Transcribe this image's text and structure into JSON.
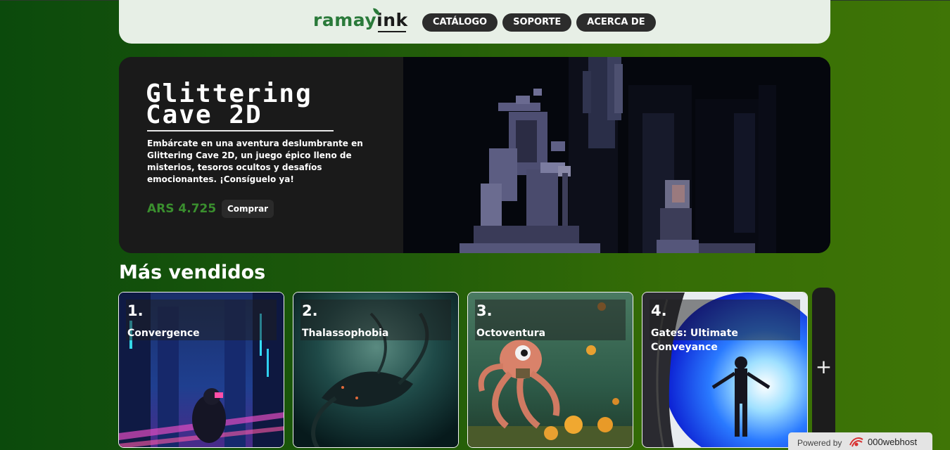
{
  "header": {
    "logo_part1": "ramay",
    "logo_part2": "ink",
    "nav": [
      "CATÁLOGO",
      "SOPORTE",
      "ACERCA DE"
    ]
  },
  "hero": {
    "title": "Glittering Cave 2D",
    "description": "Embárcate en una aventura deslumbrante en Glittering Cave 2D, un juego épico lleno de misterios, tesoros ocultos y desafíos emocionantes. ¡Consíguelo ya!",
    "price": "ARS 4.725",
    "buy_label": "Comprar"
  },
  "bestsellers": {
    "title": "Más vendidos",
    "items": [
      {
        "rank": "1.",
        "name": "Convergence"
      },
      {
        "rank": "2.",
        "name": "Thalassophobia"
      },
      {
        "rank": "3.",
        "name": "Octoventura"
      },
      {
        "rank": "4.",
        "name": "Gates: Ultimate Conveyance"
      }
    ],
    "more_label": "+"
  },
  "footer_badge": {
    "powered_label": "Powered by",
    "brand": "000webhost"
  },
  "colors": {
    "accent_green": "#3a8f2e",
    "header_bg": "#e7efe6",
    "nav_button": "#2c2c2c"
  }
}
